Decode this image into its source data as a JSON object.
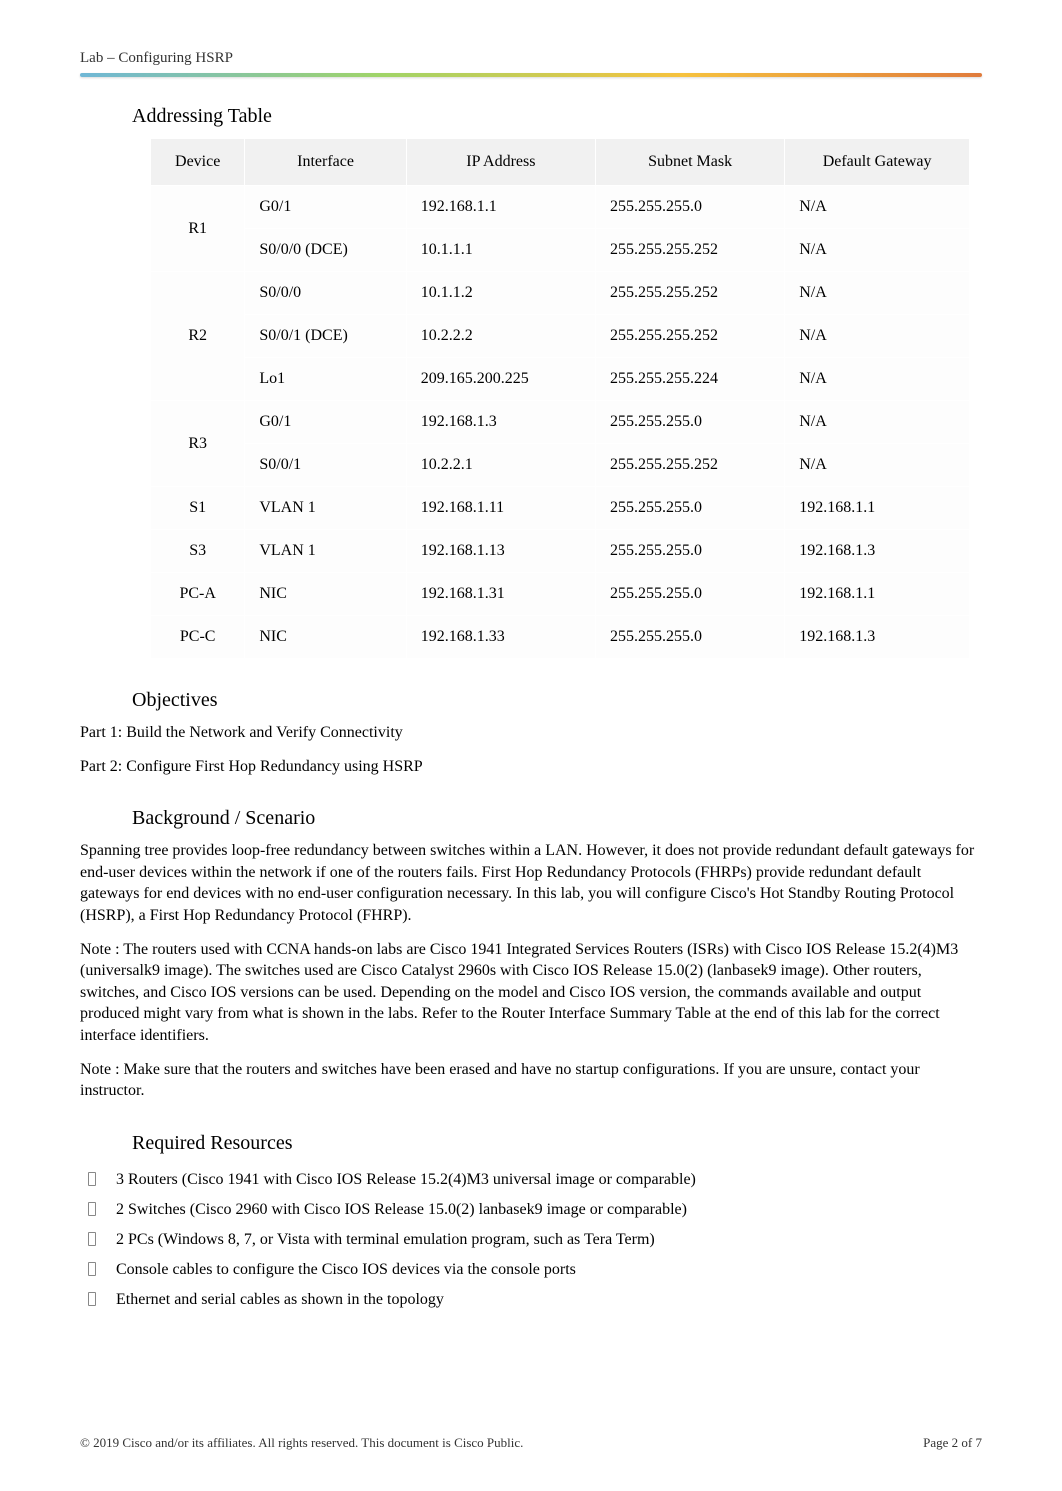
{
  "header": {
    "title": "Lab – Configuring HSRP"
  },
  "sections": {
    "addressing_title": "Addressing Table",
    "objectives_title": "Objectives",
    "background_title": "Background / Scenario",
    "resources_title": "Required Resources"
  },
  "table": {
    "headers": {
      "device": "Device",
      "interface": "Interface",
      "ip": "IP Address",
      "mask": "Subnet Mask",
      "gateway": "Default Gateway"
    },
    "rows": [
      {
        "device": "R1",
        "rowspan": 2,
        "interface": "G0/1",
        "ip": "192.168.1.1",
        "mask": "255.255.255.0",
        "gateway": "N/A"
      },
      {
        "interface": "S0/0/0 (DCE)",
        "ip": "10.1.1.1",
        "mask": "255.255.255.252",
        "gateway": "N/A"
      },
      {
        "device": "R2",
        "rowspan": 3,
        "interface": "S0/0/0",
        "ip": "10.1.1.2",
        "mask": "255.255.255.252",
        "gateway": "N/A"
      },
      {
        "interface": "S0/0/1 (DCE)",
        "ip": "10.2.2.2",
        "mask": "255.255.255.252",
        "gateway": "N/A"
      },
      {
        "interface": "Lo1",
        "ip": "209.165.200.225",
        "mask": "255.255.255.224",
        "gateway": "N/A"
      },
      {
        "device": "R3",
        "rowspan": 2,
        "interface": "G0/1",
        "ip": "192.168.1.3",
        "mask": "255.255.255.0",
        "gateway": "N/A"
      },
      {
        "interface": "S0/0/1",
        "ip": "10.2.2.1",
        "mask": "255.255.255.252",
        "gateway": "N/A"
      },
      {
        "device": "S1",
        "rowspan": 1,
        "interface": "VLAN 1",
        "ip": "192.168.1.11",
        "mask": "255.255.255.0",
        "gateway": "192.168.1.1"
      },
      {
        "device": "S3",
        "rowspan": 1,
        "interface": "VLAN 1",
        "ip": "192.168.1.13",
        "mask": "255.255.255.0",
        "gateway": "192.168.1.3"
      },
      {
        "device": "PC-A",
        "rowspan": 1,
        "interface": "NIC",
        "ip": "192.168.1.31",
        "mask": "255.255.255.0",
        "gateway": "192.168.1.1"
      },
      {
        "device": "PC-C",
        "rowspan": 1,
        "interface": "NIC",
        "ip": "192.168.1.33",
        "mask": "255.255.255.0",
        "gateway": "192.168.1.3"
      }
    ]
  },
  "objectives": {
    "part1": "Part 1: Build the Network and Verify Connectivity",
    "part2": "Part 2: Configure First Hop Redundancy using HSRP"
  },
  "background": {
    "p1": "Spanning tree provides loop-free redundancy between switches within a LAN. However, it does not provide redundant default gateways for end-user devices within the network if one of the routers fails. First Hop Redundancy Protocols (FHRPs) provide redundant default gateways for end devices with no end-user configuration necessary. In this lab, you will configure Cisco's Hot Standby Routing Protocol (HSRP), a First Hop Redundancy Protocol (FHRP).",
    "p2": "Note : The routers used with CCNA hands-on labs are Cisco 1941 Integrated Services Routers (ISRs) with Cisco IOS Release 15.2(4)M3 (universalk9 image). The switches used are Cisco Catalyst 2960s with Cisco IOS Release 15.0(2) (lanbasek9 image). Other routers, switches, and Cisco IOS versions can be used. Depending on the model and Cisco IOS version, the commands available and output produced might vary from what is shown in the labs. Refer to the Router Interface Summary Table at the end of this lab for the correct interface identifiers.",
    "p3": "Note : Make sure that the routers and switches have been erased and have no startup configurations. If you are unsure, contact your instructor."
  },
  "resources": {
    "items": [
      "3 Routers (Cisco 1941 with Cisco IOS Release 15.2(4)M3 universal image or comparable)",
      "2 Switches (Cisco 2960 with Cisco IOS Release 15.0(2) lanbasek9 image or comparable)",
      "2 PCs (Windows 8, 7, or Vista with terminal emulation program, such as Tera Term)",
      "Console cables to configure the Cisco IOS devices via the console ports",
      "Ethernet and serial cables as shown in the topology"
    ]
  },
  "footer": {
    "copyright": "© 2019 Cisco and/or its affiliates. All rights reserved. This document is Cisco Public.",
    "page": "Page  2 of 7"
  }
}
